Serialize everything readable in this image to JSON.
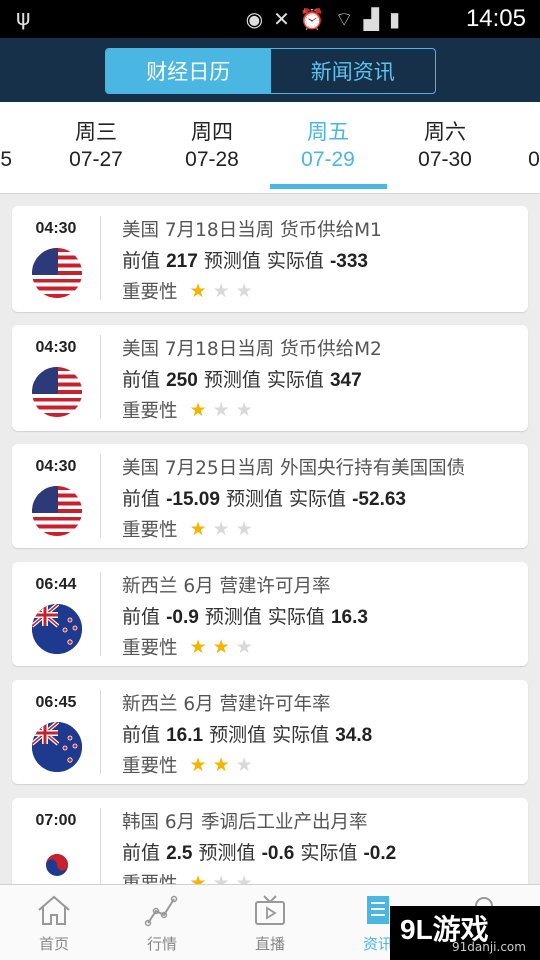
{
  "statusbar": {
    "time": "14:05"
  },
  "header": {
    "tabs": [
      {
        "label": "财经日历",
        "active": true
      },
      {
        "label": "新闻资讯",
        "active": false
      }
    ]
  },
  "dates": [
    {
      "weekday": "",
      "date": "5"
    },
    {
      "weekday": "周三",
      "date": "07-27"
    },
    {
      "weekday": "周四",
      "date": "07-28"
    },
    {
      "weekday": "周五",
      "date": "07-29",
      "active": true
    },
    {
      "weekday": "周六",
      "date": "07-30"
    },
    {
      "weekday": "",
      "date": "0"
    }
  ],
  "labels": {
    "prev": "前值",
    "forecast": "预测值",
    "actual": "实际值",
    "importance": "重要性"
  },
  "events": [
    {
      "time": "04:30",
      "flag": "us-flag",
      "title": "美国 7月18日当周 货币供给M1",
      "prev": "217",
      "forecast": "",
      "actual": "-333",
      "stars": 1
    },
    {
      "time": "04:30",
      "flag": "us-flag",
      "title": "美国 7月18日当周 货币供给M2",
      "prev": "250",
      "forecast": "",
      "actual": "347",
      "stars": 1
    },
    {
      "time": "04:30",
      "flag": "us-flag",
      "title": "美国 7月25日当周 外国央行持有美国国债",
      "prev": "-15.09",
      "forecast": "",
      "actual": "-52.63",
      "stars": 1
    },
    {
      "time": "06:44",
      "flag": "nz-flag",
      "title": "新西兰 6月 营建许可月率",
      "prev": "-0.9",
      "forecast": "",
      "actual": "16.3",
      "stars": 2
    },
    {
      "time": "06:45",
      "flag": "nz-flag",
      "title": "新西兰 6月 营建许可年率",
      "prev": "16.1",
      "forecast": "",
      "actual": "34.8",
      "stars": 2
    },
    {
      "time": "07:00",
      "flag": "kr-flag",
      "title": "韩国 6月 季调后工业产出月率",
      "prev": "2.5",
      "forecast": "-0.6",
      "actual": "-0.2",
      "stars": 1
    }
  ],
  "nav": [
    {
      "label": "首页",
      "icon": "home-icon"
    },
    {
      "label": "行情",
      "icon": "chart-icon"
    },
    {
      "label": "直播",
      "icon": "tv-icon"
    },
    {
      "label": "资讯",
      "icon": "news-icon",
      "active": true
    },
    {
      "label": "",
      "icon": "search-icon"
    }
  ],
  "watermark": {
    "brand": "9L游戏",
    "site": "91danji.com"
  },
  "colors": {
    "accent": "#4ab6e2",
    "header": "#16304a",
    "star": "#f5b400"
  }
}
